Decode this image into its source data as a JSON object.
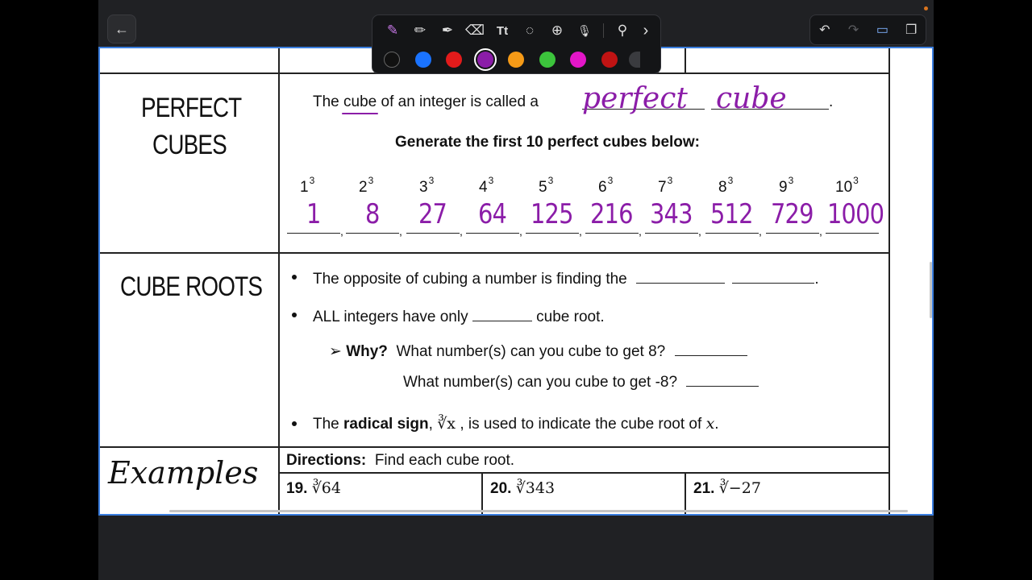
{
  "toolbar": {
    "back_icon": "←",
    "tools": [
      {
        "name": "pen-icon",
        "glyph": "✎"
      },
      {
        "name": "pencil-icon",
        "glyph": "✏"
      },
      {
        "name": "highlighter-icon",
        "glyph": "✒"
      },
      {
        "name": "eraser-icon",
        "glyph": "⌫"
      },
      {
        "name": "text-tool-icon",
        "glyph": "Tt"
      },
      {
        "name": "lasso-icon",
        "glyph": "◌"
      },
      {
        "name": "add-icon",
        "glyph": "⊕"
      },
      {
        "name": "microphone-icon",
        "glyph": "🎙"
      },
      {
        "name": "link-icon",
        "glyph": "⚲"
      },
      {
        "name": "chevron-right-icon",
        "glyph": "›"
      }
    ],
    "colors": [
      "#111111",
      "#1a73ff",
      "#e21b1b",
      "#8b1da8",
      "#f59a17",
      "#3cc43c",
      "#e316c8",
      "#c01313"
    ],
    "selected_color": "#8b1da8",
    "right": {
      "undo": "↶",
      "redo": "↷",
      "present": "▭",
      "pages": "❐"
    }
  },
  "worksheet": {
    "perfect_cubes": {
      "title_line1": "PERFECT",
      "title_line2": "CUBES",
      "sentence_before": "The",
      "sentence_word": "cube",
      "sentence_after": "of an integer is called a",
      "sentence_end": ".",
      "handwritten_1": "perfect",
      "handwritten_2": "cube",
      "instruction": "Generate the first 10 perfect cubes below:",
      "bases": [
        "1",
        "2",
        "3",
        "4",
        "5",
        "6",
        "7",
        "8",
        "9",
        "10"
      ],
      "exponent": "3",
      "answers": [
        "1",
        "8",
        "27",
        "64",
        "125",
        "216",
        "343",
        "512",
        "729",
        "1000"
      ]
    },
    "cube_roots": {
      "title": "CUBE ROOTS",
      "bullet1": "The opposite of cubing a number is finding the",
      "bullet1_end": ".",
      "bullet2_before": "ALL integers have only",
      "bullet2_after": "cube root.",
      "why_marker": "➢",
      "why_label": "Why?",
      "why_q1": "What number(s) can you cube to get 8?",
      "why_q2": "What number(s) can you cube to get -8?",
      "bullet3_before": "The",
      "bullet3_bold": "radical sign",
      "bullet3_radical": "∛x",
      "bullet3_after": ", is used to indicate the cube root of",
      "bullet3_var": "x",
      "bullet3_end": "."
    },
    "examples": {
      "label": "Examples",
      "directions_label": "Directions:",
      "directions_text": "Find each cube root.",
      "items": [
        {
          "num": "19.",
          "expr": "∛64"
        },
        {
          "num": "20.",
          "expr": "∛343"
        },
        {
          "num": "21.",
          "expr": "∛−27"
        }
      ]
    }
  }
}
